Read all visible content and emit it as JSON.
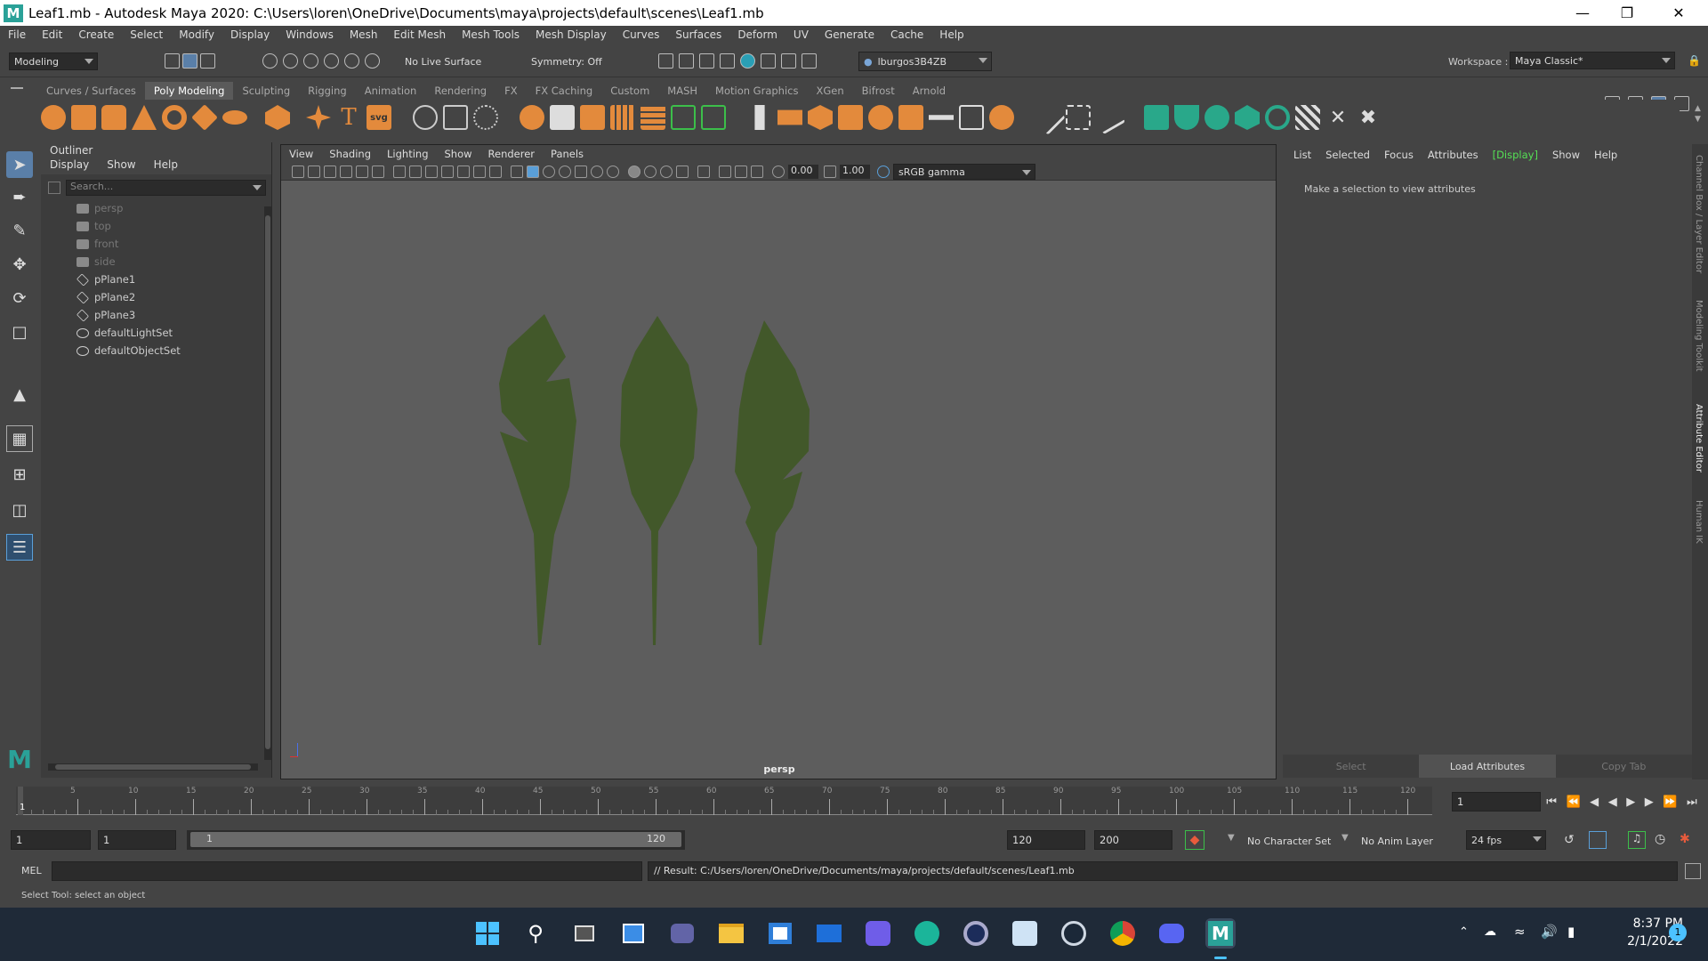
{
  "window": {
    "title": "Leaf1.mb - Autodesk Maya 2020: C:\\Users\\loren\\OneDrive\\Documents\\maya\\projects\\default\\scenes\\Leaf1.mb",
    "app_logo": "M"
  },
  "menu": [
    "File",
    "Edit",
    "Create",
    "Select",
    "Modify",
    "Display",
    "Windows",
    "Mesh",
    "Edit Mesh",
    "Mesh Tools",
    "Mesh Display",
    "Curves",
    "Surfaces",
    "Deform",
    "UV",
    "Generate",
    "Cache",
    "Help"
  ],
  "status_line": {
    "menuset": "Modeling",
    "live_surface": "No Live Surface",
    "symmetry": "Symmetry: Off",
    "user": "lburgos3B4ZB",
    "workspace_label": "Workspace :",
    "workspace": "Maya Classic*"
  },
  "shelf_tabs": [
    "Curves / Surfaces",
    "Poly Modeling",
    "Sculpting",
    "Rigging",
    "Animation",
    "Rendering",
    "FX",
    "FX Caching",
    "Custom",
    "MASH",
    "Motion Graphics",
    "XGen",
    "Bifrost",
    "Arnold"
  ],
  "shelf_active": "Poly Modeling",
  "outliner": {
    "title": "Outliner",
    "menu": [
      "Display",
      "Show",
      "Help"
    ],
    "search_placeholder": "Search...",
    "items": [
      {
        "name": "persp",
        "kind": "camera",
        "dim": true
      },
      {
        "name": "top",
        "kind": "camera",
        "dim": true
      },
      {
        "name": "front",
        "kind": "camera",
        "dim": true
      },
      {
        "name": "side",
        "kind": "camera",
        "dim": true
      },
      {
        "name": "pPlane1",
        "kind": "mesh",
        "dim": false
      },
      {
        "name": "pPlane2",
        "kind": "mesh",
        "dim": false
      },
      {
        "name": "pPlane3",
        "kind": "mesh",
        "dim": false
      },
      {
        "name": "defaultLightSet",
        "kind": "set",
        "dim": false
      },
      {
        "name": "defaultObjectSet",
        "kind": "set",
        "dim": false
      }
    ]
  },
  "viewport": {
    "menu": [
      "View",
      "Shading",
      "Lighting",
      "Show",
      "Renderer",
      "Panels"
    ],
    "exposure": "0.00",
    "gamma": "1.00",
    "color_space": "sRGB gamma",
    "camera_label": "persp",
    "leaf_color": "#42582a"
  },
  "attribute_editor": {
    "menu": [
      "List",
      "Selected",
      "Focus",
      "Attributes",
      "[Display]",
      "Show",
      "Help"
    ],
    "message": "Make a selection to view attributes",
    "buttons": [
      "Select",
      "Load Attributes",
      "Copy Tab"
    ]
  },
  "side_tabs": [
    "Channel Box / Layer Editor",
    "Modeling Toolkit",
    "Attribute Editor",
    "Human IK"
  ],
  "timeline": {
    "ticks": [
      "5",
      "10",
      "15",
      "20",
      "25",
      "30",
      "35",
      "40",
      "45",
      "50",
      "55",
      "60",
      "65",
      "70",
      "75",
      "80",
      "85",
      "90",
      "95",
      "100",
      "105",
      "110",
      "115",
      "120"
    ],
    "current_marker": "1",
    "current_frame": "1"
  },
  "range": {
    "start": "1",
    "anim_start": "1",
    "slider_start": "1",
    "slider_end": "120",
    "anim_end": "120",
    "end": "200",
    "character_set": "No Character Set",
    "anim_layer": "No Anim Layer",
    "fps": "24 fps"
  },
  "command_line": {
    "label": "MEL",
    "result": "// Result: C:/Users/loren/OneDrive/Documents/maya/projects/default/scenes/Leaf1.mb"
  },
  "help_line": "Select Tool: select an object",
  "taskbar": {
    "time": "8:37 PM",
    "date": "2/1/2022",
    "notification_count": "1"
  }
}
